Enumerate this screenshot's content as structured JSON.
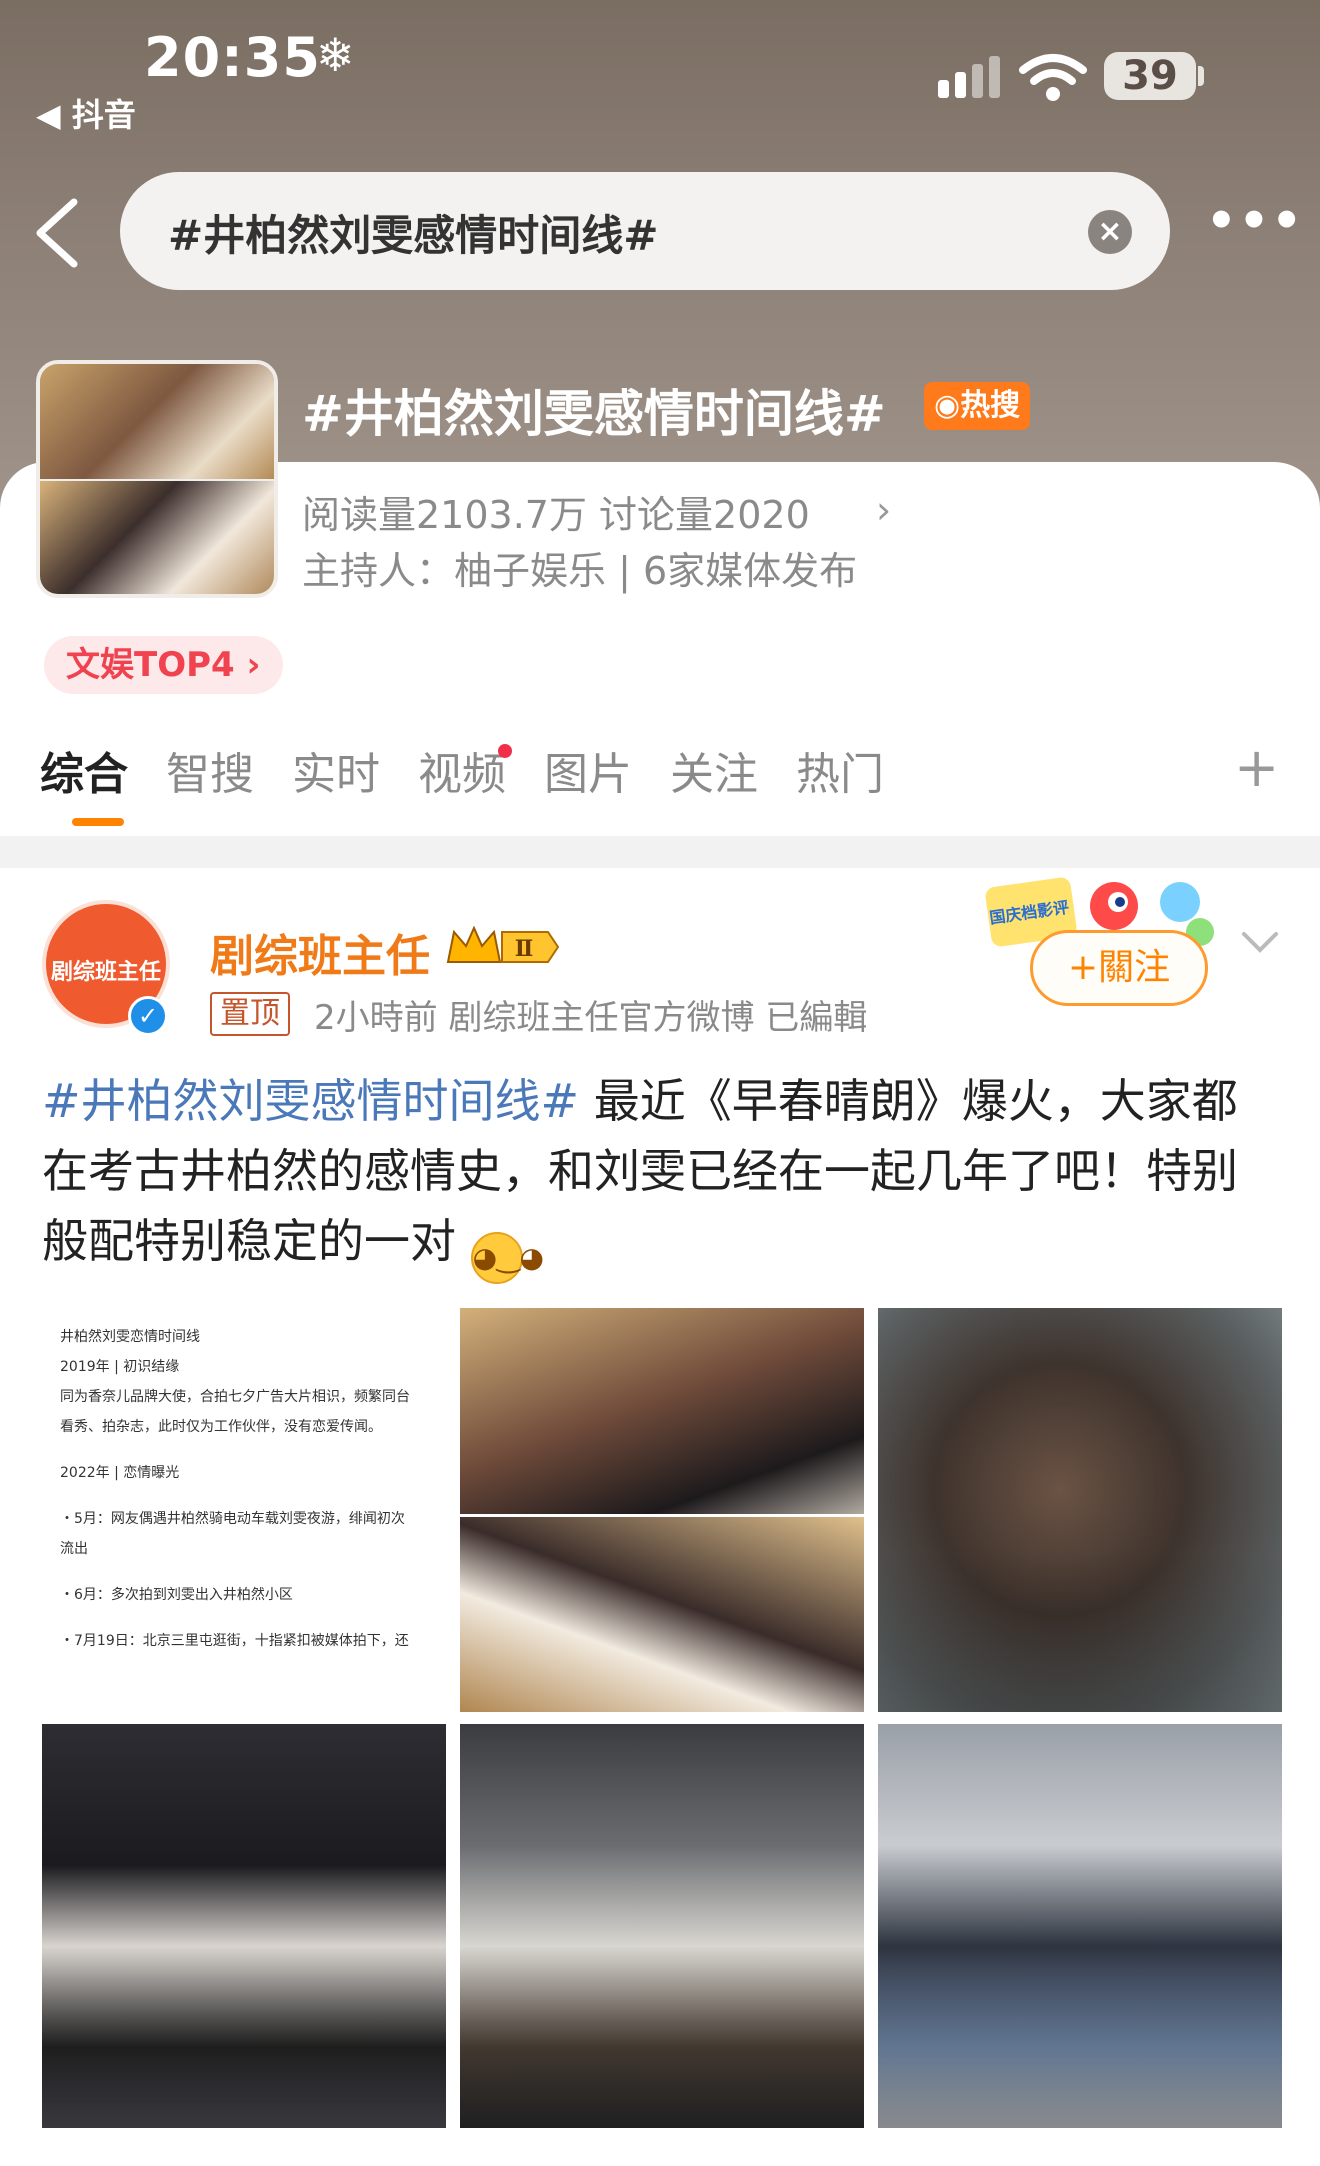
{
  "status_bar": {
    "time": "20:35",
    "weather_icon": "snowflake-icon",
    "back_app": "抖音",
    "battery": "39"
  },
  "search": {
    "query": "#井柏然刘雯感情时间线#"
  },
  "topic": {
    "title": "#井柏然刘雯感情时间线#",
    "hot_badge": "热搜",
    "stats": "阅读量2103.7万  讨论量2020",
    "host": "主持人：柚子娱乐 | 6家媒体发布",
    "rank": "文娱TOP4"
  },
  "tabs": [
    "综合",
    "智搜",
    "实时",
    "视频",
    "图片",
    "关注",
    "热门"
  ],
  "post": {
    "author": "剧综班主任",
    "avatar_text": "剧综班主任",
    "pin_label": "置顶",
    "meta": "2小時前  剧综班主任官方微博  已編輯",
    "follow_label": "+關注",
    "sticker_label": "国庆档影评",
    "vip_level": "Ⅱ",
    "hashtag": "#井柏然刘雯感情时间线#",
    "body": " 最近《早春晴朗》爆火，大家都在考古井柏然的感情史，和刘雯已经在一起几年了吧！特别般配特别稳定的一对"
  },
  "doc_image": {
    "lines": [
      "井柏然刘雯恋情时间线",
      "2019年 | 初识结缘",
      "同为香奈儿品牌大使，合拍七夕广告大片相识，频繁同台",
      "看秀、拍杂志，此时仅为工作伙伴，没有恋爱传闻。",
      "",
      "2022年 | 恋情曝光",
      "",
      "・5月：网友偶遇井柏然骑电动车载刘雯夜游，绯闻初次",
      "流出",
      "",
      "・6月：多次拍到刘雯出入井柏然小区",
      "",
      "・7月19日：北京三里屯逛街，十指紧扣被媒体拍下，还"
    ]
  },
  "colors": {
    "accent": "#ff8200",
    "hot": "#ff7a1a",
    "link": "#4a78b8",
    "rank": "#f0424f"
  }
}
